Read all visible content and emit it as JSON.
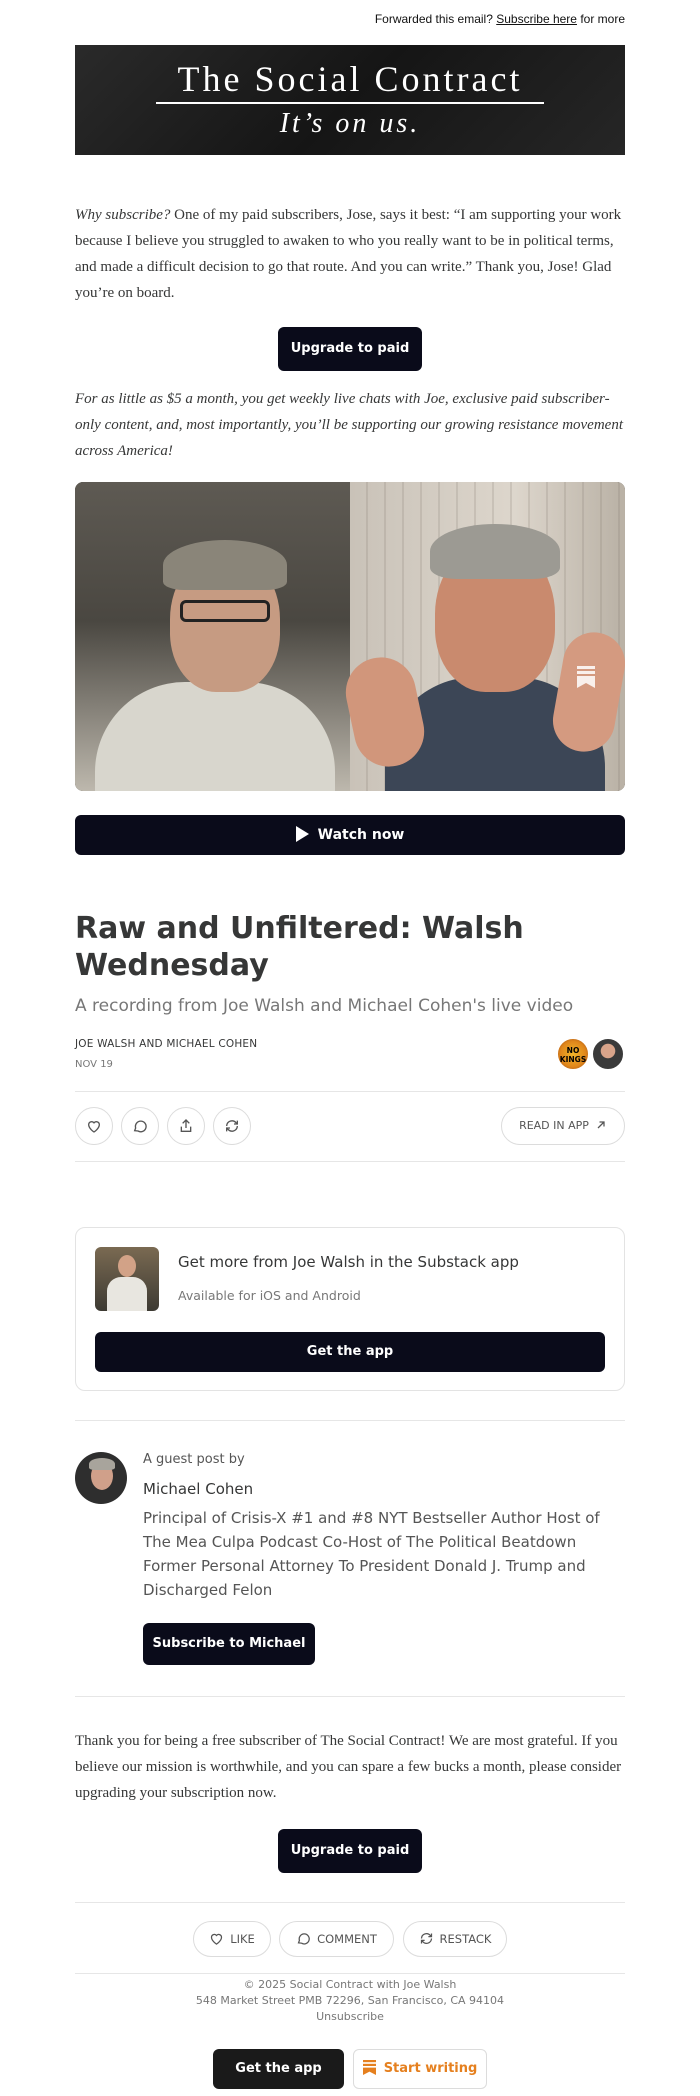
{
  "forwarded": {
    "text": "Forwarded this email?",
    "link": "Subscribe here",
    "suffix": "for more"
  },
  "banner": {
    "title": "The Social Contract",
    "tagline": "It’s on us."
  },
  "intro": {
    "lead": "Why subscribe?",
    "body": " One of my paid subscribers, Jose, says it best: “I am supporting your work because I believe you struggled to awaken to who you really want to be in political terms, and made a difficult decision to go that route. And you can write.” Thank you, Jose! Glad you’re on board."
  },
  "upgrade_label": "Upgrade to paid",
  "pitch": "For as little as $5 a month, you get weekly live chats with Joe, exclusive paid subscriber-only content, and, most importantly, you’ll be supporting our growing resistance movement across America!",
  "video": {
    "watch_label": "Watch now"
  },
  "post": {
    "title": "Raw and Unfiltered: Walsh Wednesday",
    "subtitle": "A recording from Joe Walsh and Michael Cohen's live video",
    "byline": "JOE WALSH AND MICHAEL COHEN",
    "date": "NOV 19",
    "avatar_badge": "NO KINGS"
  },
  "actions": {
    "read_in_app": "READ IN APP"
  },
  "app_card": {
    "title": "Get more from Joe Walsh in the Substack app",
    "subtitle": "Available for iOS and Android",
    "button": "Get the app"
  },
  "guest": {
    "label": "A guest post by",
    "name": "Michael Cohen",
    "bio": "Principal of Crisis-X #1 and #8 NYT Bestseller Author Host of The Mea Culpa Podcast Co-Host of The Political Beatdown Former Personal Attorney To President Donald J. Trump and Discharged Felon",
    "subscribe_button": "Subscribe to Michael"
  },
  "closing": "Thank you for being a free subscriber of The Social Contract! We are most grateful. If you believe our mission is worthwhile, and you can spare a few bucks a month, please consider upgrading your subscription now.",
  "bottom_actions": {
    "like": "LIKE",
    "comment": "COMMENT",
    "restack": "RESTACK"
  },
  "footer": {
    "copyright": "© 2025 Social Contract with Joe Walsh",
    "address": "548 Market Street PMB 72296, San Francisco, CA 94104",
    "unsubscribe": "Unsubscribe",
    "get_app": "Get the app",
    "start_writing": "Start writing"
  },
  "colors": {
    "button_dark": "#0a0b1a",
    "accent_orange": "#e5801f"
  }
}
